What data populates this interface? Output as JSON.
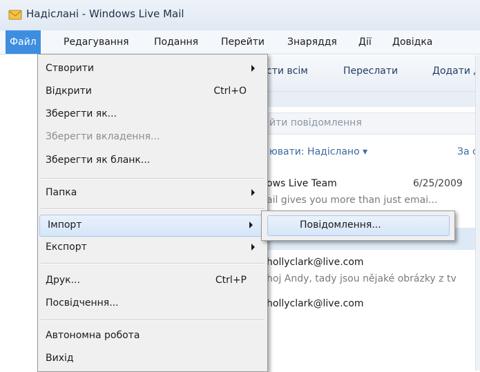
{
  "window": {
    "title": "Надіслані - Windows Live Mail"
  },
  "menubar": {
    "items": [
      "Файл",
      "Редагування",
      "Подання",
      "Перейти",
      "Знаряддя",
      "Дії",
      "Довідка"
    ]
  },
  "toolbar": {
    "reply_all": "сти всім",
    "forward": "Переслати",
    "add": "Додати д"
  },
  "search": {
    "placeholder": "йти повідомлення"
  },
  "sort": {
    "label": "ювати: Надіслано ▾",
    "right": "За с"
  },
  "messages": [
    {
      "sender": "ows Live Team",
      "date": "6/25/2009",
      "preview": "ail gives you more than just emai..."
    },
    {
      "sender": "hollyclark@live.com",
      "preview": "hoj Andy, tady jsou nějaké obrázky z tv"
    },
    {
      "sender": "hollyclark@live.com"
    }
  ],
  "file_menu": {
    "create": "Створити",
    "open": "Відкрити",
    "open_shortcut": "Ctrl+O",
    "save_as": "Зберегти як...",
    "save_attachments": "Зберегти вкладення...",
    "save_as_stationery": "Зберегти як бланк...",
    "folder": "Папка",
    "import": "Імпорт",
    "export": "Експорт",
    "print": "Друк...",
    "print_shortcut": "Ctrl+P",
    "identities": "Посвідчення...",
    "work_offline": "Автономна робота",
    "exit": "Вихід"
  },
  "import_submenu": {
    "messages": "Повідомлення..."
  }
}
